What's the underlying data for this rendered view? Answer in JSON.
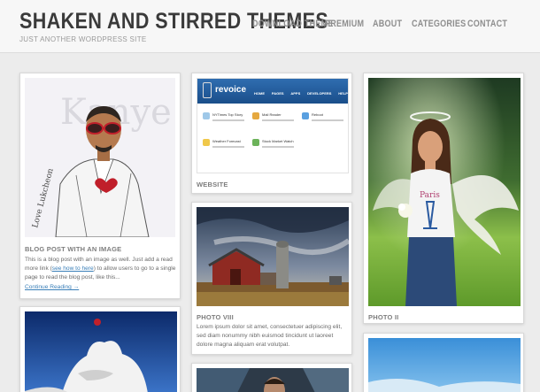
{
  "site": {
    "title": "SHAKEN AND STIRRED THEMES",
    "tagline": "JUST ANOTHER WORDPRESS SITE"
  },
  "nav": {
    "items": [
      "DOWNLOAD THEME",
      "PREMIUM",
      "ABOUT",
      "CATEGORIES",
      "CONTACT"
    ]
  },
  "posts": {
    "post1": {
      "title": "BLOG POST WITH AN IMAGE",
      "excerpt_before": "This is a blog post with an image as well. Just add a read more link (",
      "excerpt_link": "see how to here",
      "excerpt_after": ") to allow users to go to a single page to read the blog post, like this...",
      "more": "Continue Reading →",
      "image_text": "Kanye West",
      "signature": "Love Lukcheon"
    },
    "website": {
      "title": "WEBSITE",
      "logo": "revoice",
      "nav": [
        "HOME",
        "PAGES",
        "APPS",
        "DEVELOPERS",
        "HELP"
      ],
      "items": [
        "NYTimes Top Story",
        "Mail Reader",
        "Reboot",
        "Weather Forecast",
        "Stock Market Watch"
      ]
    },
    "photo8": {
      "title": "PHOTO VIII",
      "excerpt": "Lorem ipsum dolor sit amet, consectetuer adipiscing elit, sed diam nonummy nibh euismod tincidunt ut laoreet dolore magna aliquam erat volutpat."
    },
    "photo2": {
      "title": "PHOTO II",
      "shirt_text": "Paris"
    }
  },
  "colors": {
    "link": "#3a7fb8",
    "header_bg": "#f7f7f7",
    "page_bg": "#ececec",
    "title_text": "#3a3a3a",
    "nav_text": "#8e8e8e"
  }
}
